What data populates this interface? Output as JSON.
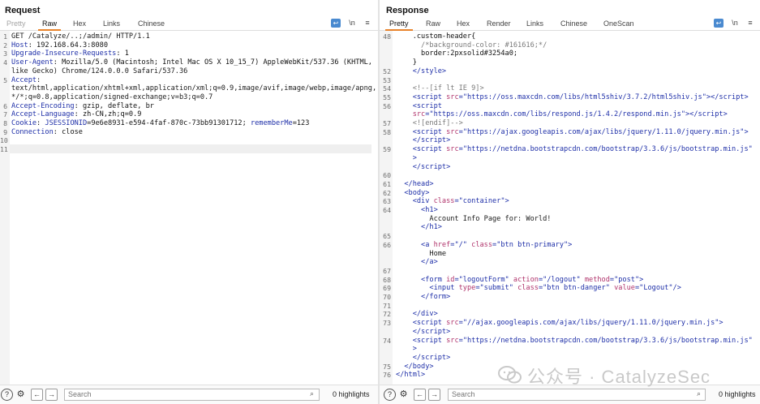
{
  "request": {
    "title": "Request",
    "tabs": [
      "Pretty",
      "Raw",
      "Hex",
      "Links",
      "Chinese"
    ],
    "active_tab": "Raw",
    "wrap_icon": "wrap-lines-icon",
    "newline_label": "\\n",
    "menu_icon": "hamburger-menu-icon",
    "lines": [
      {
        "n": "1",
        "text": "GET /Catalyze/..;/admin/ HTTP/1.1"
      },
      {
        "n": "2",
        "k": "Host",
        "v": ": 192.168.64.3:8080"
      },
      {
        "n": "3",
        "k": "Upgrade-Insecure-Requests",
        "v": ": 1"
      },
      {
        "n": "4",
        "k": "User-Agent",
        "v": ": Mozilla/5.0 (Macintosh; Intel Mac OS X 10_15_7) AppleWebKit/537.36 (KHTML,"
      },
      {
        "n": "",
        "text": "like Gecko) Chrome/124.0.0.0 Safari/537.36"
      },
      {
        "n": "5",
        "k": "Accept",
        "v": ":"
      },
      {
        "n": "",
        "text": "text/html,application/xhtml+xml,application/xml;q=0.9,image/avif,image/webp,image/apng,"
      },
      {
        "n": "",
        "text": "*/*;q=0.8,application/signed-exchange;v=b3;q=0.7"
      },
      {
        "n": "6",
        "k": "Accept-Encoding",
        "v": ": gzip, deflate, br"
      },
      {
        "n": "7",
        "k": "Accept-Language",
        "v": ": zh-CN,zh;q=0.9"
      },
      {
        "n": "8",
        "k": "Cookie",
        "v": ": ",
        "cookie1_k": "JSESSIONID",
        "cookie1_v": "=9e6e8931-e594-4faf-870c-73bb91301712",
        "sep": "; ",
        "cookie2_k": "rememberMe",
        "cookie2_v": "=123"
      },
      {
        "n": "9",
        "k": "Connection",
        "v": ": close"
      },
      {
        "n": "10",
        "text": ""
      },
      {
        "n": "11",
        "text": ""
      }
    ]
  },
  "response": {
    "title": "Response",
    "tabs": [
      "Pretty",
      "Raw",
      "Hex",
      "Render",
      "Links",
      "Chinese",
      "OneScan"
    ],
    "active_tab": "Pretty",
    "lines": [
      {
        "n": "48",
        "html": "    <span class=\"css\">.custom-header{</span>"
      },
      {
        "n": "",
        "html": "      <span class=\"cm\">/*background-color: #161616;*/</span>"
      },
      {
        "n": "",
        "html": "      <span class=\"css\">border:2pxsolid#3254a0;</span>"
      },
      {
        "n": "",
        "html": "    <span class=\"css\">}</span>"
      },
      {
        "n": "52",
        "html": "    <span class=\"tag\">&lt;/style&gt;</span>"
      },
      {
        "n": "53",
        "html": ""
      },
      {
        "n": "54",
        "html": "    <span class=\"cm\">&lt;!--[if lt IE 9]&gt;</span>"
      },
      {
        "n": "55",
        "html": "    <span class=\"tag\">&lt;script </span><span class=\"attr\">src</span><span class=\"tag\">=\"https://oss.maxcdn.com/libs/html5shiv/3.7.2/html5shiv.js\"&gt;&lt;/script&gt;</span>"
      },
      {
        "n": "56",
        "html": "    <span class=\"tag\">&lt;script</span>"
      },
      {
        "n": "",
        "html": "    <span class=\"attr\">src</span><span class=\"tag\">=\"https://oss.maxcdn.com/libs/respond.js/1.4.2/respond.min.js\"&gt;&lt;/script&gt;</span>"
      },
      {
        "n": "57",
        "html": "    <span class=\"cm\">&lt;![endif]--&gt;</span>"
      },
      {
        "n": "58",
        "html": "    <span class=\"tag\">&lt;script </span><span class=\"attr\">src</span><span class=\"tag\">=\"https://ajax.googleapis.com/ajax/libs/jquery/1.11.0/jquery.min.js\"&gt;</span>"
      },
      {
        "n": "",
        "html": "    <span class=\"tag\">&lt;/script&gt;</span>"
      },
      {
        "n": "59",
        "html": "    <span class=\"tag\">&lt;script </span><span class=\"attr\">src</span><span class=\"tag\">=\"https://netdna.bootstrapcdn.com/bootstrap/3.3.6/js/bootstrap.min.js\"</span>"
      },
      {
        "n": "",
        "html": "    <span class=\"tag\">&gt;</span>"
      },
      {
        "n": "",
        "html": "    <span class=\"tag\">&lt;/script&gt;</span>"
      },
      {
        "n": "60",
        "html": ""
      },
      {
        "n": "61",
        "html": "  <span class=\"tag\">&lt;/head&gt;</span>"
      },
      {
        "n": "62",
        "html": "  <span class=\"tag\">&lt;body&gt;</span>"
      },
      {
        "n": "63",
        "html": "    <span class=\"tag\">&lt;div </span><span class=\"attr\">class</span><span class=\"tag\">=\"container\"&gt;</span>"
      },
      {
        "n": "64",
        "html": "      <span class=\"tag\">&lt;h1&gt;</span>"
      },
      {
        "n": "",
        "html": "        Account Info Page for: World!"
      },
      {
        "n": "",
        "html": "      <span class=\"tag\">&lt;/h1&gt;</span>"
      },
      {
        "n": "65",
        "html": ""
      },
      {
        "n": "66",
        "html": "      <span class=\"tag\">&lt;a </span><span class=\"attr\">href</span><span class=\"tag\">=\"/\" </span><span class=\"attr\">class</span><span class=\"tag\">=\"btn btn-primary\"&gt;</span>"
      },
      {
        "n": "",
        "html": "        Home"
      },
      {
        "n": "",
        "html": "      <span class=\"tag\">&lt;/a&gt;</span>"
      },
      {
        "n": "67",
        "html": ""
      },
      {
        "n": "68",
        "html": "      <span class=\"tag\">&lt;form </span><span class=\"attr\">id</span><span class=\"tag\">=\"logoutForm\" </span><span class=\"attr\">action</span><span class=\"tag\">=\"/logout\" </span><span class=\"attr\">method</span><span class=\"tag\">=\"post\"&gt;</span>"
      },
      {
        "n": "69",
        "html": "        <span class=\"tag\">&lt;input </span><span class=\"attr\">type</span><span class=\"tag\">=\"submit\" </span><span class=\"attr\">class</span><span class=\"tag\">=\"btn btn-danger\" </span><span class=\"attr\">value</span><span class=\"tag\">=\"Logout\"/&gt;</span>"
      },
      {
        "n": "70",
        "html": "      <span class=\"tag\">&lt;/form&gt;</span>"
      },
      {
        "n": "71",
        "html": ""
      },
      {
        "n": "72",
        "html": "    <span class=\"tag\">&lt;/div&gt;</span>"
      },
      {
        "n": "73",
        "html": "    <span class=\"tag\">&lt;script </span><span class=\"attr\">src</span><span class=\"tag\">=\"//ajax.googleapis.com/ajax/libs/jquery/1.11.0/jquery.min.js\"&gt;</span>"
      },
      {
        "n": "",
        "html": "    <span class=\"tag\">&lt;/script&gt;</span>"
      },
      {
        "n": "74",
        "html": "    <span class=\"tag\">&lt;script </span><span class=\"attr\">src</span><span class=\"tag\">=\"https://netdna.bootstrapcdn.com/bootstrap/3.3.6/js/bootstrap.min.js\"</span>"
      },
      {
        "n": "",
        "html": "    <span class=\"tag\">&gt;</span>"
      },
      {
        "n": "",
        "html": "    <span class=\"tag\">&lt;/script&gt;</span>"
      },
      {
        "n": "75",
        "html": "  <span class=\"tag\">&lt;/body&gt;</span>"
      },
      {
        "n": "76",
        "html": "<span class=\"tag\">&lt;/html&gt;</span>"
      }
    ]
  },
  "bottom": {
    "search_placeholder": "Search",
    "highlights_label": "0 highlights",
    "help_icon": "help-icon",
    "settings_icon": "gear-icon",
    "back_icon": "arrow-left-icon",
    "forward_icon": "arrow-right-icon"
  },
  "watermark": {
    "text": "公众号 · CatalyzeSec"
  },
  "colors": {
    "accent_tab": "#e8822a",
    "wrap_button": "#4a8ad0",
    "header_key": "#1e2fa8",
    "attribute": "#b0336b"
  }
}
